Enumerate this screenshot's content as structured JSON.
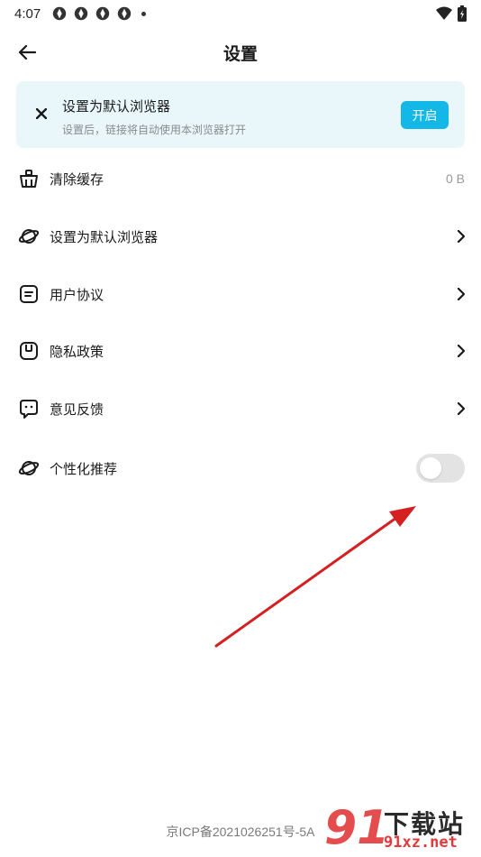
{
  "status_bar": {
    "time": "4:07"
  },
  "header": {
    "title": "设置"
  },
  "banner": {
    "title": "设置为默认浏览器",
    "subtitle": "设置后，链接将自动使用本浏览器打开",
    "button_label": "开启"
  },
  "menu": {
    "items": [
      {
        "label": "清除缓存",
        "value": "0 B",
        "icon": "basket-icon"
      },
      {
        "label": "设置为默认浏览器",
        "icon": "planet-icon"
      },
      {
        "label": "用户协议",
        "icon": "document-icon"
      },
      {
        "label": "隐私政策",
        "icon": "privacy-icon"
      },
      {
        "label": "意见反馈",
        "icon": "feedback-icon"
      },
      {
        "label": "个性化推荐",
        "icon": "planet-icon",
        "toggle_on": false
      }
    ]
  },
  "footer": {
    "icp": "京ICP备2021026251号-5A"
  },
  "watermark": {
    "number": "91",
    "title": "下载站",
    "domain": "91xz.net"
  },
  "colors": {
    "accent": "#14b8e6",
    "banner_bg": "#e9f7fb",
    "arrow": "#d42020",
    "watermark_red": "#e23a3a"
  }
}
